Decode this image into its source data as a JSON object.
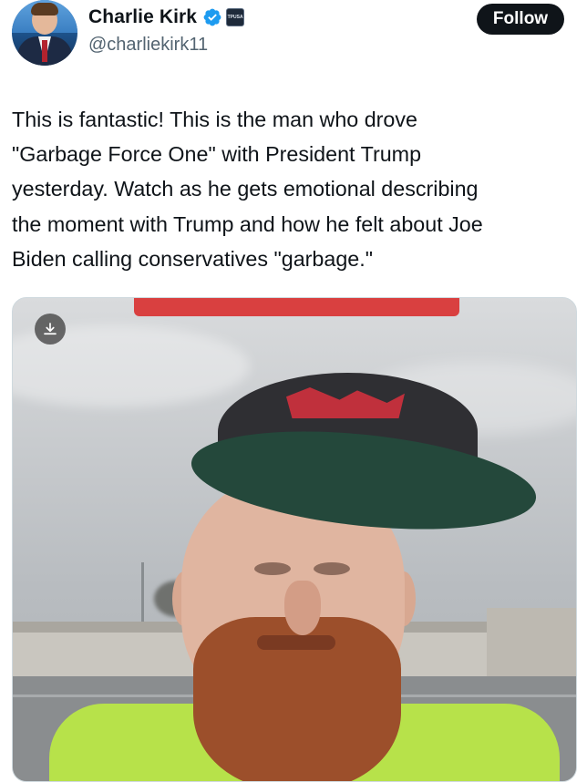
{
  "author": {
    "name": "Charlie Kirk",
    "handle": "@charliekirk11",
    "verified": true,
    "avatar_icon": "profile-photo",
    "badge_icon": "organization-badge",
    "badge_text": "TPUSA"
  },
  "actions": {
    "follow_label": "Follow"
  },
  "tweet": {
    "text": "This is fantastic! This is the man who drove\n\"Garbage Force One\" with President Trump\nyesterday. Watch as he gets emotional describing\nthe moment with Trump and how he felt about Joe\nBiden calling conservatives \"garbage.\""
  },
  "media": {
    "type": "video",
    "download_icon": "download-icon"
  },
  "colors": {
    "verified_blue": "#1d9bf0",
    "follow_button_bg": "#0f1419",
    "handle_gray": "#536471"
  }
}
